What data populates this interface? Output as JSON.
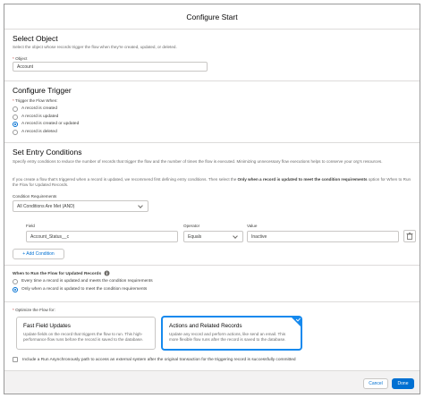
{
  "modal": {
    "title": "Configure Start"
  },
  "select_object": {
    "title": "Select Object",
    "help": "Select the object whose records trigger the flow when they're created, updated, or deleted.",
    "object_label": "Object",
    "object_value": "Account"
  },
  "configure_trigger": {
    "title": "Configure Trigger",
    "trigger_label": "Trigger the Flow When:",
    "options": [
      "A record is created",
      "A record is updated",
      "A record is created or updated",
      "A record is deleted"
    ],
    "selected_index": 2
  },
  "entry_conditions": {
    "title": "Set Entry Conditions",
    "help1": "Specify entry conditions to reduce the number of records that trigger the flow and the number of times the flow is executed. Minimizing unnecessary flow executions helps to conserve your org's resources.",
    "help2_pre": "If you create a flow that's triggered when a record is updated, we recommend first defining entry conditions. Then select the ",
    "help2_bold": "Only when a record is updated to meet the condition requirements",
    "help2_post": " option for When to Run the Flow for Updated Records.",
    "requirements_label": "Condition Requirements",
    "requirements_value": "All Conditions Are Met (AND)",
    "field_label": "Field",
    "operator_label": "Operator",
    "value_label": "Value",
    "field_value": "Account_Status__c",
    "operator_value": "Equals",
    "value_value": "Inactive",
    "add_condition_label": "+ Add Condition"
  },
  "when_to_run": {
    "title": "When to Run the Flow for Updated Records",
    "options": [
      "Every time a record is updated and meets the condition requirements",
      "Only when a record is updated to meet the condition requirements"
    ],
    "selected_index": 1
  },
  "optimize": {
    "label": "Optimize the Flow for:",
    "cards": [
      {
        "title": "Fast Field Updates",
        "desc": "Update fields on the record that triggers the flow to run. This high-performance flow runs before the record is saved to the database."
      },
      {
        "title": "Actions and Related Records",
        "desc": "Update any record and perform actions, like send an email. This more flexible flow runs after the record is saved to the database."
      }
    ],
    "selected_index": 1
  },
  "async": {
    "label": "Include a Run Asynchronously path to access an external system after the original transaction for the triggering record is successfully committed"
  },
  "footer": {
    "cancel_label": "Cancel",
    "done_label": "Done"
  },
  "colors": {
    "brand": "#0070d2",
    "selected_border": "#1589ee",
    "required": "#c23934"
  }
}
